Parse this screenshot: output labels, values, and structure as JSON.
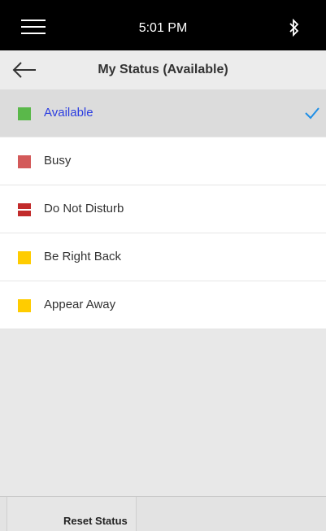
{
  "status_bar": {
    "time": "5:01 PM",
    "menu_icon": "hamburger-menu-icon",
    "bluetooth_icon": "bluetooth-icon"
  },
  "header": {
    "back_icon": "back-arrow-icon",
    "title": "My Status (Available)"
  },
  "statuses": [
    {
      "label": "Available",
      "color": "#5ab84a",
      "selected": true
    },
    {
      "label": "Busy",
      "color": "#d35a5a",
      "selected": false
    },
    {
      "label": "Do Not Disturb",
      "color": "#c22b2b",
      "selected": false
    },
    {
      "label": "Be Right Back",
      "color": "#ffcc00",
      "selected": false
    },
    {
      "label": "Appear Away",
      "color": "#ffcc00",
      "selected": false
    }
  ],
  "selected_check_icon": "checkmark-icon",
  "colors": {
    "selected_text": "#2b3de0",
    "check": "#1e8ee6"
  },
  "footer": {
    "reset_label": "Reset Status"
  }
}
